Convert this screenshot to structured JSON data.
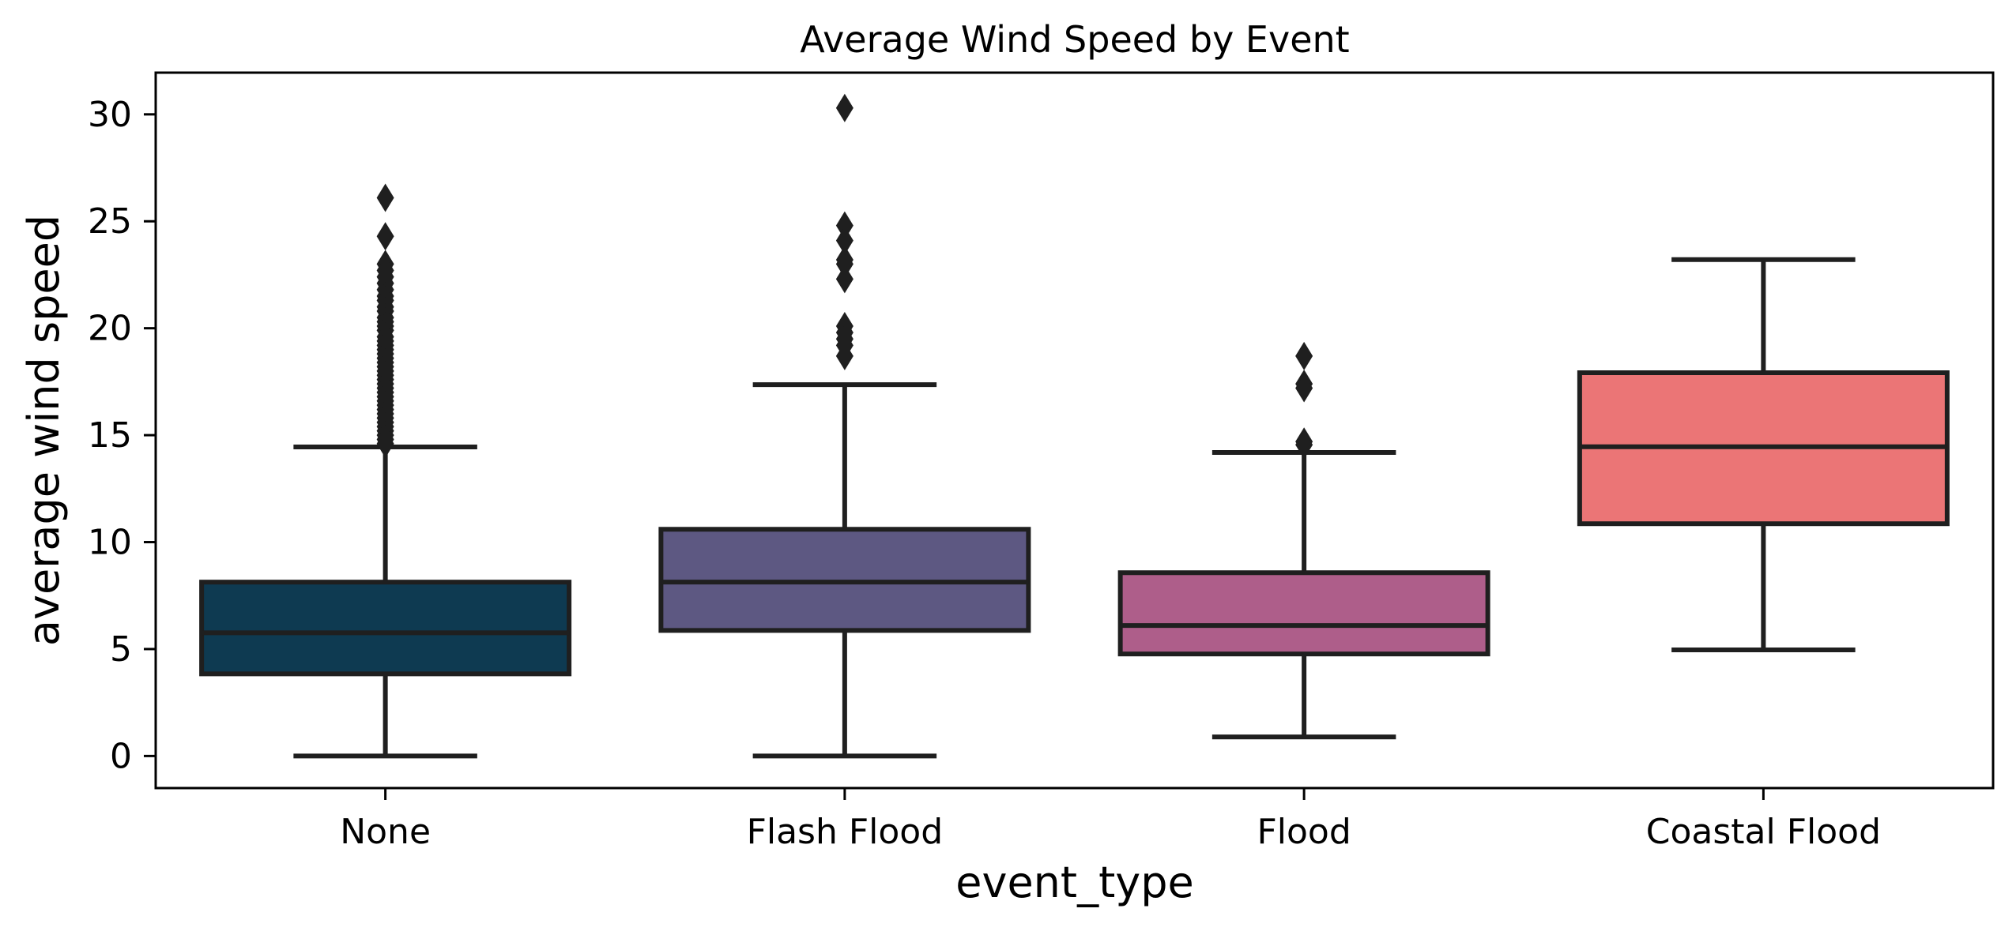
{
  "chart_data": {
    "type": "box",
    "title": "Average Wind Speed by Event",
    "xlabel": "event_type",
    "ylabel": "average wind speed",
    "categories": [
      "None",
      "Flash Flood",
      "Flood",
      "Coastal Flood"
    ],
    "ylim": [
      -1.5,
      31.95
    ],
    "yticks": [
      0,
      5,
      10,
      15,
      20,
      25,
      30
    ],
    "ytick_labels": [
      "0",
      "5",
      "10",
      "15",
      "20",
      "25",
      "30"
    ],
    "grid": false,
    "legend": "none",
    "edge_color": "#1f1f1f",
    "series": [
      {
        "name": "None",
        "color": "#0e3a51",
        "whisker_low": 0.0,
        "q1": 3.84,
        "median": 5.76,
        "q3": 8.13,
        "whisker_high": 14.45,
        "outliers": [
          26.1,
          24.3,
          23.0,
          22.7,
          22.4,
          22.1,
          21.8,
          21.5,
          21.3,
          21.0,
          20.8,
          20.5,
          20.3,
          20.1,
          19.9,
          19.6,
          19.4,
          19.2,
          19.0,
          18.8,
          18.6,
          18.4,
          18.2,
          18.0,
          17.8,
          17.6,
          17.4,
          17.2,
          17.0,
          16.8,
          16.6,
          16.4,
          16.2,
          16.0,
          15.8,
          15.6,
          15.4,
          15.2,
          15.0,
          14.8,
          14.6
        ]
      },
      {
        "name": "Flash Flood",
        "color": "#5d5882",
        "whisker_low": 0.0,
        "q1": 5.87,
        "median": 8.13,
        "q3": 10.6,
        "whisker_high": 17.36,
        "outliers": [
          30.3,
          24.8,
          24.1,
          23.2,
          23.0,
          22.3,
          20.1,
          19.8,
          19.5,
          19.2,
          18.7
        ]
      },
      {
        "name": "Flood",
        "color": "#ae5e8a",
        "whisker_low": 0.89,
        "q1": 4.77,
        "median": 6.1,
        "q3": 8.57,
        "whisker_high": 14.19,
        "outliers": [
          18.7,
          17.4,
          17.2,
          14.7,
          14.55
        ]
      },
      {
        "name": "Coastal Flood",
        "color": "#eb7576",
        "whisker_low": 4.96,
        "q1": 10.86,
        "median": 14.46,
        "q3": 17.92,
        "whisker_high": 23.21,
        "outliers": []
      }
    ]
  }
}
